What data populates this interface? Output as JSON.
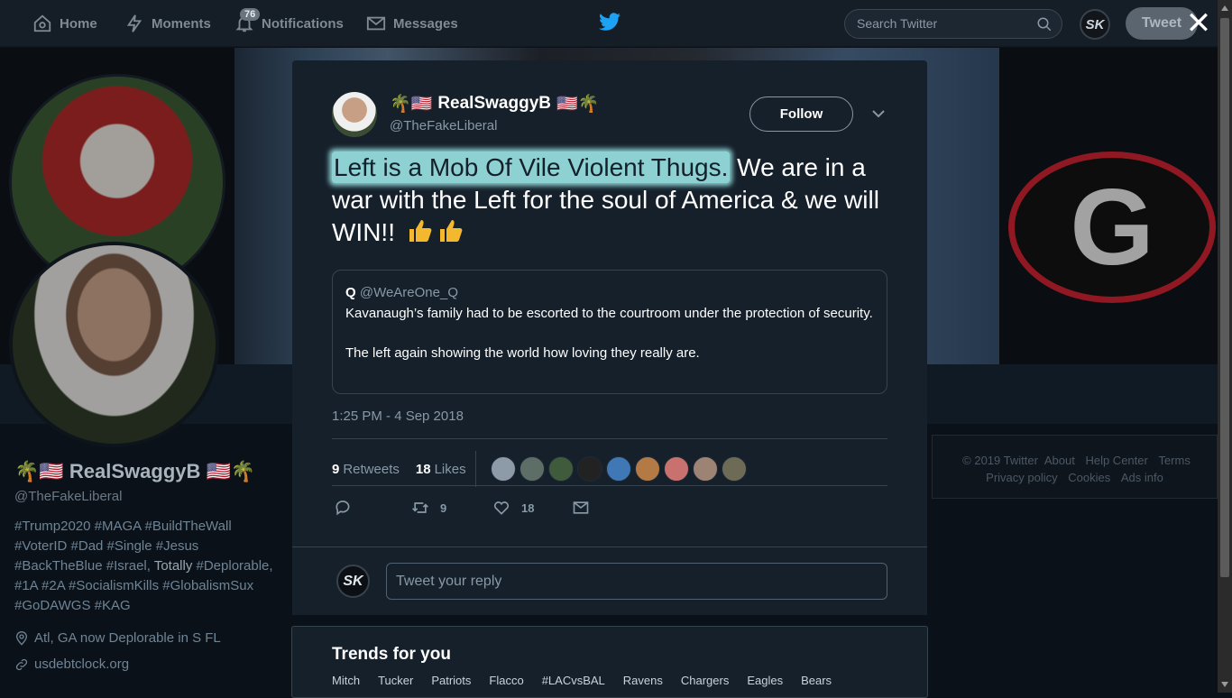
{
  "nav": {
    "home": "Home",
    "moments": "Moments",
    "notifications": "Notifications",
    "notifications_count": "76",
    "messages": "Messages",
    "search_placeholder": "Search Twitter",
    "user_avatar_initials": "SK",
    "tweet_button": "Tweet"
  },
  "profile": {
    "name": "🌴🇺🇸 RealSwaggyB 🇺🇸🌴",
    "handle": "@TheFakeLiberal",
    "bio_tags_1": "#Trump2020 #MAGA #BuildTheWall #VoterID #Dad #Single #Jesus #BackTheBlue #Israel, ",
    "bio_plain": "Totally",
    "bio_tags_2": " #Deplorable, #1A #2A #SocialismKills #GlobalismSux #GoDAWGS #KAG",
    "location": "Atl, GA now Deplorable in S FL",
    "website": "usdebtclock.org"
  },
  "footer": {
    "copyright": "© 2019 Twitter",
    "about": "About",
    "help": "Help Center",
    "terms": "Terms",
    "privacy": "Privacy policy",
    "cookies": "Cookies",
    "ads": "Ads info"
  },
  "tweet": {
    "author_name": "RealSwaggyB",
    "author_emoji_left": "🌴🇺🇸",
    "author_emoji_right": "🇺🇸🌴",
    "author_handle": "@TheFakeLiberal",
    "follow_label": "Follow",
    "text_highlighted": "Left is a Mob Of Vile Violent Thugs.",
    "text_rest": " We are in a war with the Left for the soul of America & we will WIN!! ",
    "quote": {
      "author_name": "Q",
      "author_handle": "@WeAreOne_Q",
      "line1": "Kavanaugh’s family had to be escorted to the courtroom under the protection of security.",
      "line2": "The left again showing the world how loving they really are."
    },
    "timestamp": "1:25 PM - 4 Sep 2018",
    "retweets_count": "9",
    "retweets_label": "Retweets",
    "likes_count": "18",
    "likes_label": "Likes",
    "action_retweets": "9",
    "action_likes": "18",
    "reply_placeholder": "Tweet your reply",
    "reply_avatar_initials": "SK"
  },
  "trends": {
    "title": "Trends for you",
    "items": [
      "Mitch",
      "Tucker",
      "Patriots",
      "Flacco",
      "#LACvsBAL",
      "Ravens",
      "Chargers",
      "Eagles",
      "Bears"
    ]
  },
  "colors": {
    "accent": "#1da1f2",
    "highlight": "#8ed1d3",
    "modal_bg": "#15202b"
  },
  "likers": [
    "#8d9aa7",
    "#5d6e66",
    "#3f5b3c",
    "#222222",
    "#3f78b5",
    "#b47a45",
    "#c9716e",
    "#9c8374",
    "#6d6a55"
  ]
}
